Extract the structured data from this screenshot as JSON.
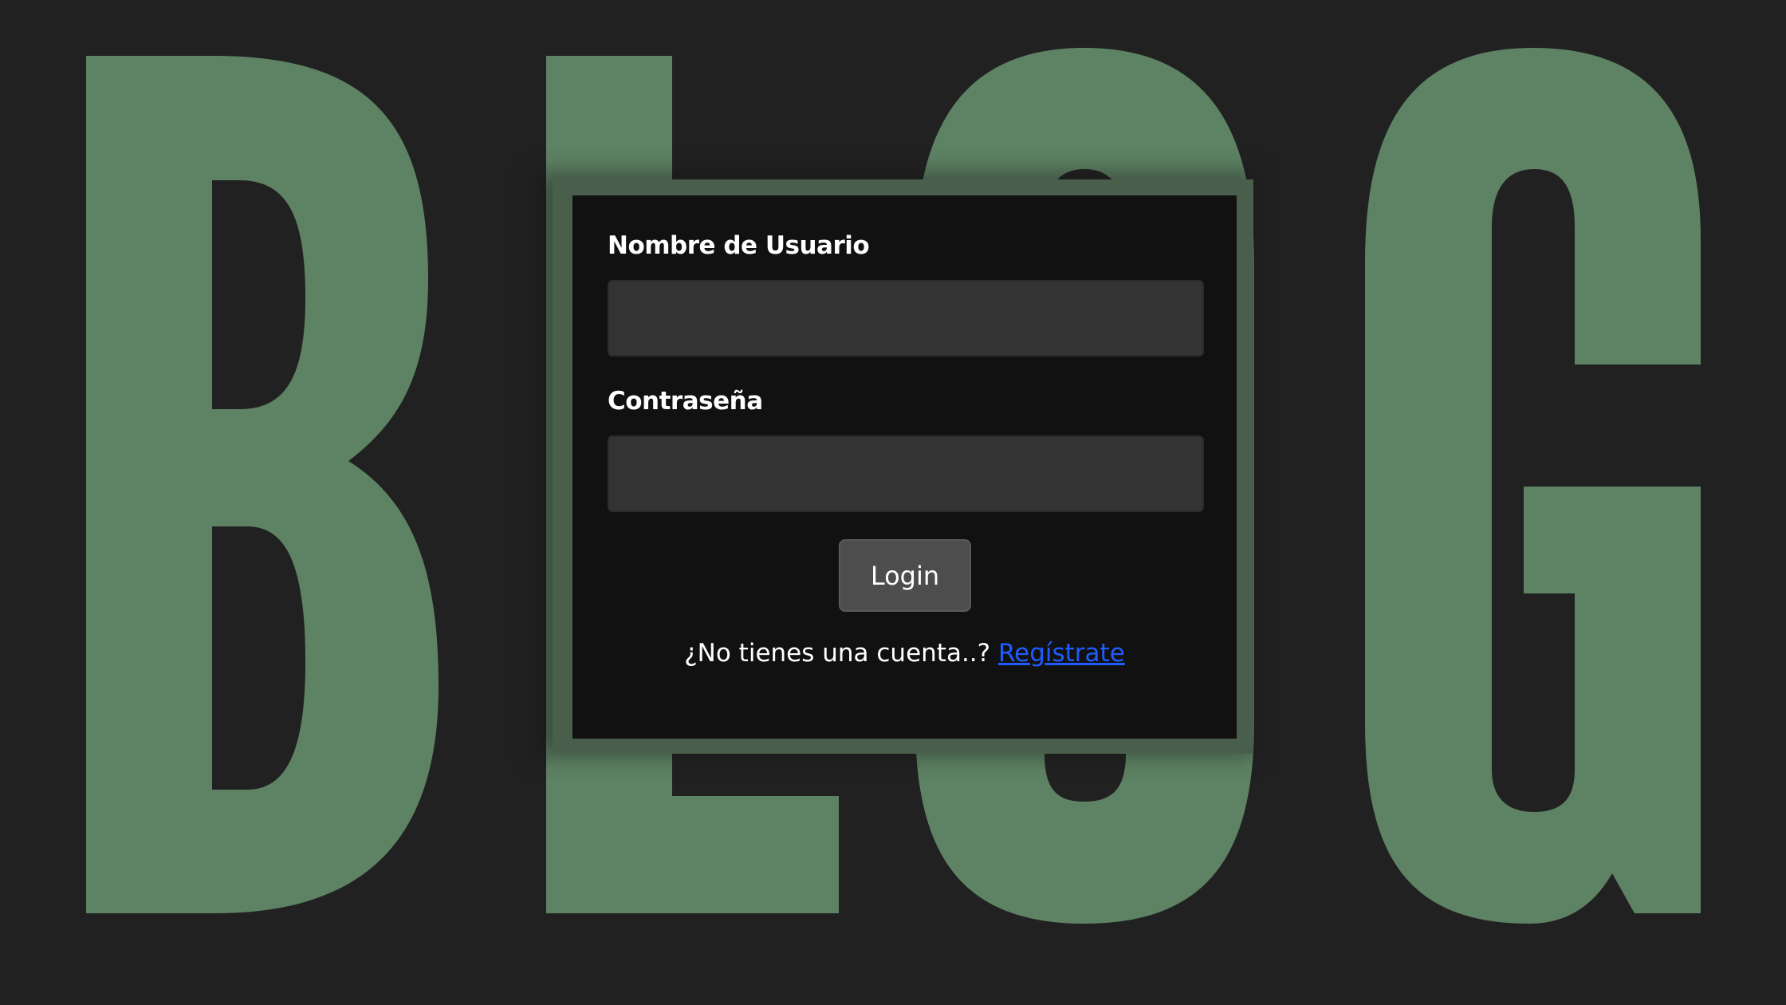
{
  "background": {
    "word": "BLOG",
    "letter_color": "#5e8264",
    "bg_color": "#212121"
  },
  "login_form": {
    "username_label": "Nombre de Usuario",
    "username_value": "",
    "password_label": "Contraseña",
    "password_value": "",
    "login_button": "Login",
    "signup_prompt": "¿No tienes una cuenta..?",
    "signup_link": "Regístrate",
    "link_color": "#1f5bff"
  }
}
